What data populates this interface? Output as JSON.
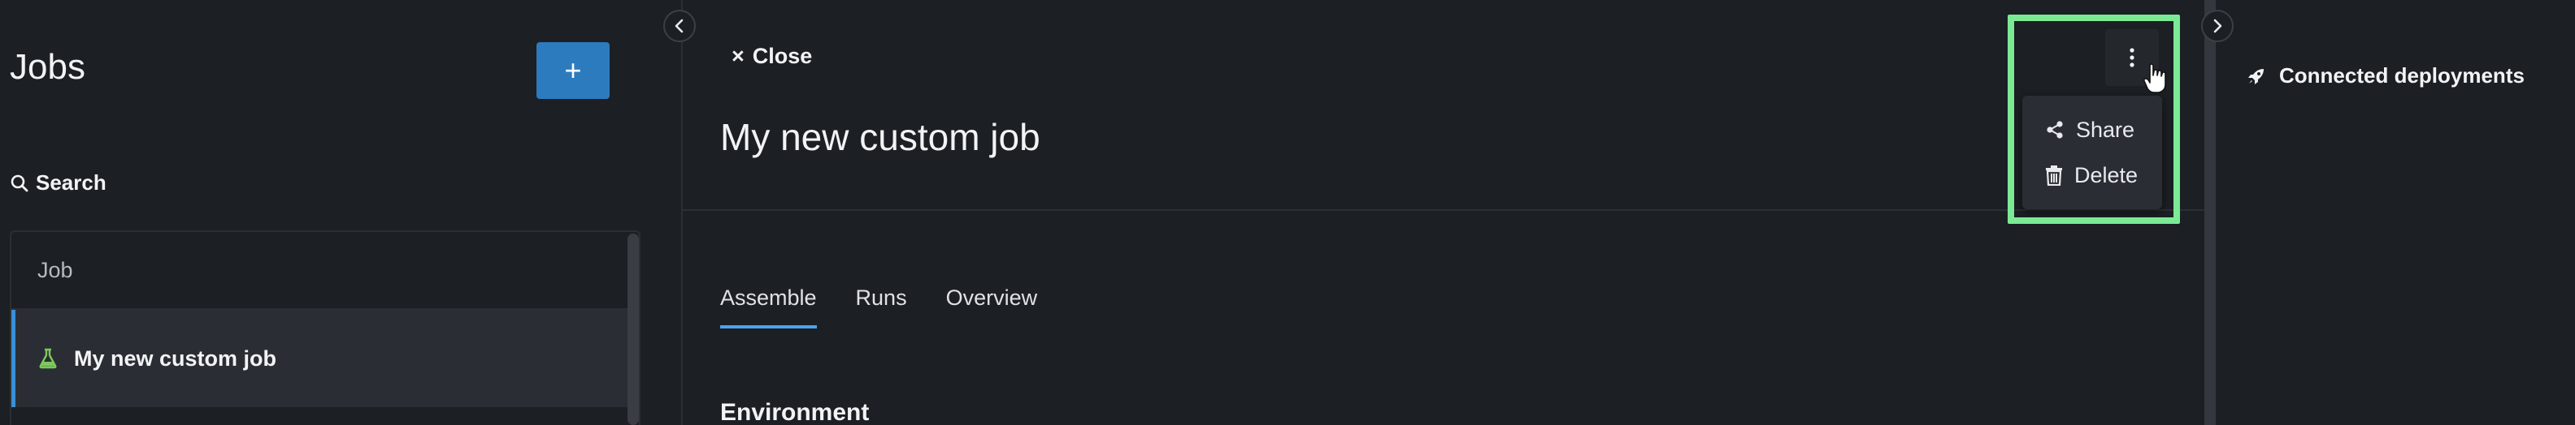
{
  "left_panel": {
    "title": "Jobs",
    "add_button_label": "+",
    "search_label": "Search",
    "list_header": "Job",
    "items": [
      {
        "label": "My new custom job",
        "icon": "flask-icon",
        "selected": true
      }
    ]
  },
  "main": {
    "close_icon": "×",
    "close_label": "Close",
    "title": "My new custom job",
    "tabs": [
      {
        "label": "Assemble",
        "active": true
      },
      {
        "label": "Runs",
        "active": false
      },
      {
        "label": "Overview",
        "active": false
      }
    ],
    "section_title": "Environment",
    "menu": {
      "items": [
        {
          "label": "Share",
          "icon": "share-icon"
        },
        {
          "label": "Delete",
          "icon": "trash-icon"
        }
      ]
    }
  },
  "right_panel": {
    "title": "Connected deployments",
    "icon": "rocket-icon"
  },
  "colors": {
    "background": "#1c1f23",
    "accent": "#2d7bbf",
    "tab_underline": "#4aa3ef",
    "highlight": "#7bea95",
    "flask_icon": "#7cc95a"
  }
}
